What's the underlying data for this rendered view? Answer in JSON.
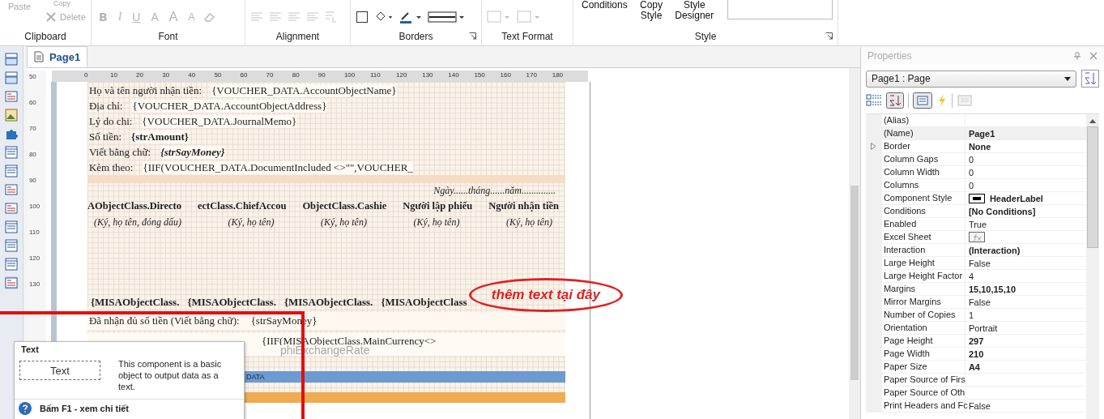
{
  "ribbon": {
    "groups": [
      {
        "label": "Clipboard",
        "kind": "clipboard",
        "buttons": [
          {
            "label": "Paste",
            "disabled": true
          },
          {
            "label": "Copy",
            "disabled": true
          },
          {
            "label": "Delete",
            "disabled": true
          }
        ]
      },
      {
        "label": "Font",
        "kind": "font",
        "glyphs": [
          {
            "glyph": "B",
            "kind": "bold"
          },
          {
            "glyph": "I",
            "kind": "italic"
          },
          {
            "glyph": "U",
            "kind": "underline"
          },
          {
            "glyph": "A",
            "kind": "color"
          },
          {
            "glyph": "A",
            "kind": "grow"
          },
          {
            "glyph": "A",
            "kind": "shrink"
          }
        ]
      },
      {
        "label": "Alignment",
        "kind": "alignment"
      },
      {
        "label": "Borders",
        "kind": "borders",
        "launcher": true
      },
      {
        "label": "Text Format",
        "kind": "format"
      },
      {
        "label": "Style",
        "kind": "style",
        "launcher": true,
        "buttons": [
          {
            "label": "Conditions",
            "disabled": false
          },
          {
            "label": "Copy Style",
            "disabled": false
          },
          {
            "label": "Style Designer",
            "disabled": false
          }
        ]
      }
    ]
  },
  "document": {
    "tab": {
      "label": "Page1",
      "selected": true
    },
    "ruler": {
      "horizontal": [
        "0",
        "10",
        "20",
        "30",
        "40",
        "50",
        "60",
        "70",
        "80",
        "90",
        "100",
        "110",
        "120",
        "130",
        "140",
        "150",
        "160",
        "170",
        "180"
      ],
      "vertical": [
        "50",
        "60",
        "70",
        "80",
        "90",
        "100",
        "110",
        "120",
        "130"
      ]
    },
    "fields": [
      {
        "label": "Họ và tên người nhận tiền:",
        "value": "{VOUCHER_DATA.AccountObjectName}",
        "bold": false,
        "italic": false
      },
      {
        "label": "Địa chỉ:",
        "value": "{VOUCHER_DATA.AccountObjectAddress}",
        "bold": false,
        "italic": false
      },
      {
        "label": "Lý do chi:",
        "value": "{VOUCHER_DATA.JournalMemo}",
        "bold": false,
        "italic": false
      },
      {
        "label": "Số tiền:",
        "value": "{strAmount}",
        "bold": true,
        "italic": false
      },
      {
        "label": "Viết bằng chữ:",
        "value": "{strSayMoney}",
        "bold": true,
        "italic": true
      },
      {
        "label": "Kèm theo:",
        "value": "{IIF(VOUCHER_DATA.DocumentIncluded <>\"\",VOUCHER_",
        "bold": false,
        "italic": false
      }
    ],
    "date_line": "Ngày......tháng......năm..............",
    "signatures": [
      {
        "title": "AObjectClass.Directo",
        "hint": "(Ký, họ tên, đóng dấu)"
      },
      {
        "title": "ectClass.ChiefAccou",
        "hint": "(Ký, họ tên)"
      },
      {
        "title": "ObjectClass.Cashie",
        "hint": "(Ký, họ tên)"
      },
      {
        "title": "Người lập phiếu",
        "hint": "(Ký, họ tên)"
      },
      {
        "title": "Người nhận tiền",
        "hint": "(Ký, họ tên)"
      }
    ],
    "misa_cells": [
      "{MISAObjectClass.",
      "{MISAObjectClass.",
      "{MISAObjectClass.",
      "{MISAObjectClass"
    ],
    "received": {
      "label": "Đã nhận đủ số tiền (Viết bằng chữ):",
      "value": "{strSayMoney}"
    },
    "currency_line": "{IIF(MISAObjectClass.MainCurrency<>",
    "faded_text": "phiExchangeRate",
    "data_band": "DATA",
    "annotation": "thêm text tại đây"
  },
  "tooltip": {
    "title": "Text",
    "sample": "Text",
    "description": "This component is a basic object to output data as a text.",
    "footer": "Bấm F1 - xem chi tiết"
  },
  "properties": {
    "title": "Properties",
    "object": "Page1 : Page",
    "rows": [
      {
        "name": "(Alias)",
        "kind": "text",
        "selected": false,
        "expandable": false
      },
      {
        "name": "(Name)",
        "value": "Page1",
        "kind": "text",
        "bold": true,
        "selected": true,
        "expandable": false
      },
      {
        "name": "Border",
        "value": "None",
        "kind": "text",
        "bold": true,
        "selected": false,
        "expandable": true
      },
      {
        "name": "Column Gaps",
        "value": "0",
        "kind": "text",
        "bold": false,
        "selected": false,
        "expandable": false
      },
      {
        "name": "Column Width",
        "value": "0",
        "kind": "text",
        "bold": false,
        "selected": false,
        "expandable": false
      },
      {
        "name": "Columns",
        "value": "0",
        "kind": "text",
        "bold": false,
        "selected": false,
        "expandable": false
      },
      {
        "name": "Component Style",
        "value": "HeaderLabel",
        "kind": "swatch",
        "bold": true,
        "selected": false,
        "expandable": false
      },
      {
        "name": "Conditions",
        "value": "[No Conditions]",
        "kind": "text",
        "bold": true,
        "selected": false,
        "expandable": false
      },
      {
        "name": "Enabled",
        "value": "True",
        "kind": "text",
        "bold": false,
        "selected": false,
        "expandable": false
      },
      {
        "name": "Excel Sheet",
        "kind": "fx",
        "selected": false,
        "expandable": false
      },
      {
        "name": "Interaction",
        "value": "(Interaction)",
        "kind": "text",
        "bold": true,
        "selected": false,
        "expandable": false
      },
      {
        "name": "Large Height",
        "value": "False",
        "kind": "text",
        "bold": false,
        "selected": false,
        "expandable": false
      },
      {
        "name": "Large Height Factor",
        "value": "4",
        "kind": "text",
        "bold": false,
        "selected": false,
        "expandable": false
      },
      {
        "name": "Margins",
        "value": "15,10,15,10",
        "kind": "text",
        "bold": true,
        "selected": false,
        "expandable": false
      },
      {
        "name": "Mirror Margins",
        "value": "False",
        "kind": "text",
        "bold": false,
        "selected": false,
        "expandable": false
      },
      {
        "name": "Number of Copies",
        "value": "1",
        "kind": "text",
        "bold": false,
        "selected": false,
        "expandable": false
      },
      {
        "name": "Orientation",
        "value": "Portrait",
        "kind": "text",
        "bold": false,
        "selected": false,
        "expandable": false
      },
      {
        "name": "Page Height",
        "value": "297",
        "kind": "text",
        "bold": true,
        "selected": false,
        "expandable": false
      },
      {
        "name": "Page Width",
        "value": "210",
        "kind": "text",
        "bold": true,
        "selected": false,
        "expandable": false
      },
      {
        "name": "Paper Size",
        "value": "A4",
        "kind": "text",
        "bold": true,
        "selected": false,
        "expandable": false
      },
      {
        "name": "Paper Source of Firs",
        "kind": "text",
        "selected": false,
        "expandable": false
      },
      {
        "name": "Paper Source of Oth",
        "kind": "text",
        "selected": false,
        "expandable": false
      },
      {
        "name": "Print Headers and Fc",
        "value": "False",
        "kind": "text",
        "bold": false,
        "selected": false,
        "expandable": false
      }
    ]
  }
}
